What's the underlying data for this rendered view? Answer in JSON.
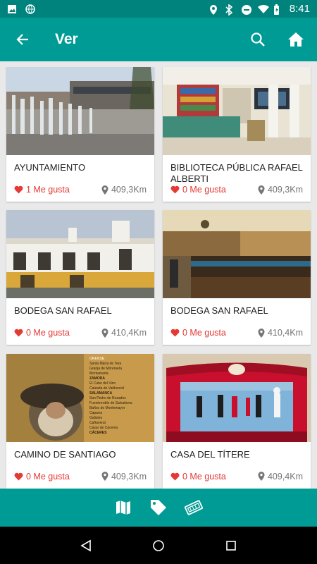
{
  "status": {
    "time": "8:41"
  },
  "appbar": {
    "title": "Ver"
  },
  "cards": [
    {
      "name": "AYUNTAMIENTO",
      "likes": "1 Me gusta",
      "distance": "409,3Km"
    },
    {
      "name": "BIBLIOTECA PÚBLICA RAFAEL ALBERTI",
      "likes": "0 Me gusta",
      "distance": "409,3Km"
    },
    {
      "name": "BODEGA SAN RAFAEL",
      "likes": "0 Me gusta",
      "distance": "410,4Km"
    },
    {
      "name": "BODEGA SAN RAFAEL",
      "likes": "0 Me gusta",
      "distance": "410,4Km"
    },
    {
      "name": "CAMINO DE SANTIAGO",
      "likes": "0 Me gusta",
      "distance": "409,3Km"
    },
    {
      "name": "CASA DEL TÍTERE",
      "likes": "0 Me gusta",
      "distance": "409,4Km"
    }
  ],
  "map_labels": [
    "ORENSE",
    "Santa Marta de Tera",
    "Granja de Moreruela",
    "Montamarta",
    "ZAMORA",
    "El Cubo del Vino",
    "Calzada de Valdunciel",
    "SALAMANCA",
    "San Pedro de Rozados",
    "Fuenterroble de Salvatierra",
    "Baños de Montemayor",
    "Caparra",
    "Galisteo",
    "Cañaveral",
    "Casar de Cáceres",
    "CÁCERES"
  ],
  "colors": {
    "primary": "#009b94",
    "statusbar": "#00837d",
    "like": "#e53935",
    "distance": "#757575"
  }
}
